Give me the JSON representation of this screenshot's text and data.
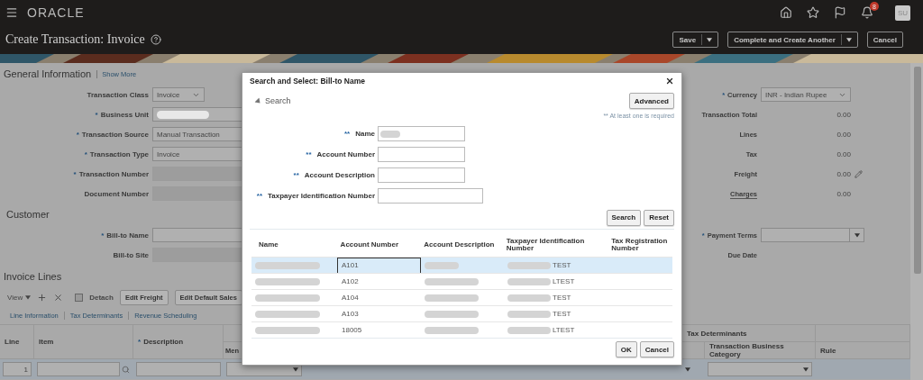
{
  "topbar": {
    "logo": "ORACLE",
    "notification_count": "8",
    "avatar": "SU"
  },
  "header": {
    "title": "Create Transaction: Invoice",
    "buttons": [
      {
        "label": "Save",
        "kind": "split"
      },
      {
        "label": "Complete and Create Another",
        "kind": "split"
      },
      {
        "label": "Cancel",
        "kind": "plain"
      }
    ]
  },
  "general": {
    "title": "General Information",
    "link": "Show More",
    "fields": [
      {
        "label": "Transaction Class",
        "kind": "select",
        "value": "Invoice"
      },
      {
        "marker": "*",
        "label": "Business Unit",
        "kind": "redacted"
      },
      {
        "marker": "*",
        "label": "Transaction Source",
        "kind": "text",
        "value": "Manual Transaction"
      },
      {
        "marker": "*",
        "label": "Transaction Type",
        "kind": "text",
        "value": "Invoice"
      },
      {
        "marker": "*",
        "label": "Transaction Number",
        "kind": "readonly"
      },
      {
        "label": "Document Number",
        "kind": "readonly"
      }
    ],
    "totals": [
      {
        "marker": "*",
        "label": "Currency",
        "kind": "select",
        "value": "INR - Indian Rupee"
      },
      {
        "label": "Transaction Total",
        "kind": "amount",
        "value": "0.00"
      },
      {
        "label": "Lines",
        "kind": "amount",
        "value": "0.00"
      },
      {
        "label": "Tax",
        "kind": "amount",
        "value": "0.00"
      },
      {
        "label": "Freight",
        "kind": "editable",
        "value": "0.00"
      },
      {
        "label": "Charges",
        "kind": "link",
        "value": "0.00"
      }
    ]
  },
  "customer": {
    "title": "Customer",
    "fields": [
      {
        "marker": "*",
        "label": "Bill-to Name",
        "kind": "input"
      },
      {
        "label": "Bill-to Site",
        "kind": "readonly"
      }
    ],
    "terms": [
      {
        "marker": "*",
        "label": "Payment Terms",
        "kind": "combo"
      },
      {
        "label": "Due Date",
        "kind": "empty"
      }
    ]
  },
  "invoice_lines": {
    "title": "Invoice Lines",
    "view_menu": "View",
    "detach": "Detach",
    "buttons": [
      "Edit Freight",
      "Edit Default Sales"
    ],
    "subtabs": [
      "Line Information",
      "Tax Determinants",
      "Revenue Scheduling"
    ],
    "columns": [
      {
        "label": "Line"
      },
      {
        "label": "Item"
      },
      {
        "marker": "*",
        "label": "Description"
      },
      {
        "label": "Men"
      }
    ],
    "group_header": "Tax Determinants",
    "group_columns": [
      "Transaction Business Category",
      "Rule"
    ],
    "rows": [
      {
        "line": "1"
      }
    ]
  },
  "dialog": {
    "title": "Search and Select: Bill-to Name",
    "section": "Search",
    "advanced": "Advanced",
    "note": "** At least one is required",
    "fields": [
      {
        "marker": "**",
        "label": "Name",
        "value_redacted": true
      },
      {
        "marker": "**",
        "label": "Account Number",
        "value_redacted": false
      },
      {
        "marker": "**",
        "label": "Account Description",
        "value_redacted": false
      },
      {
        "marker": "**",
        "label": "Taxpayer Identification Number",
        "value_redacted": false
      }
    ],
    "search_buttons": [
      "Search",
      "Reset"
    ],
    "columns": [
      "Name",
      "Account Number",
      "Account Description",
      "Taxpayer Identification Number",
      "Tax Registration Number"
    ],
    "rows": [
      {
        "account": "A101",
        "tin": "TEST",
        "selected": true
      },
      {
        "account": "A102",
        "tin": "LTEST",
        "selected": false
      },
      {
        "account": "A104",
        "tin": "TEST",
        "selected": false
      },
      {
        "account": "A103",
        "tin": "TEST",
        "selected": false
      },
      {
        "account": "18005",
        "tin": "LTEST",
        "selected": false
      }
    ],
    "footer_buttons": [
      "OK",
      "Cancel"
    ]
  }
}
